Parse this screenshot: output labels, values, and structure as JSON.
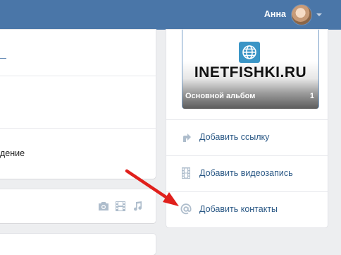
{
  "header": {
    "user_name": "Анна"
  },
  "left": {
    "partial_text": "дение"
  },
  "album": {
    "brand": "INETFISHKI.RU",
    "title": "Основной альбом",
    "count": "1"
  },
  "actions": [
    {
      "label": "Добавить ссылку",
      "icon": "link-arrow-icon"
    },
    {
      "label": "Добавить видеозапись",
      "icon": "film-icon"
    },
    {
      "label": "Добавить контакты",
      "icon": "at-sign-icon"
    }
  ],
  "media_icons": [
    "camera-icon",
    "film-icon",
    "music-icon"
  ],
  "colors": {
    "header": "#4a76a8",
    "link": "#2a5885",
    "icon": "#aebdcc",
    "arrow": "#e0201c"
  }
}
